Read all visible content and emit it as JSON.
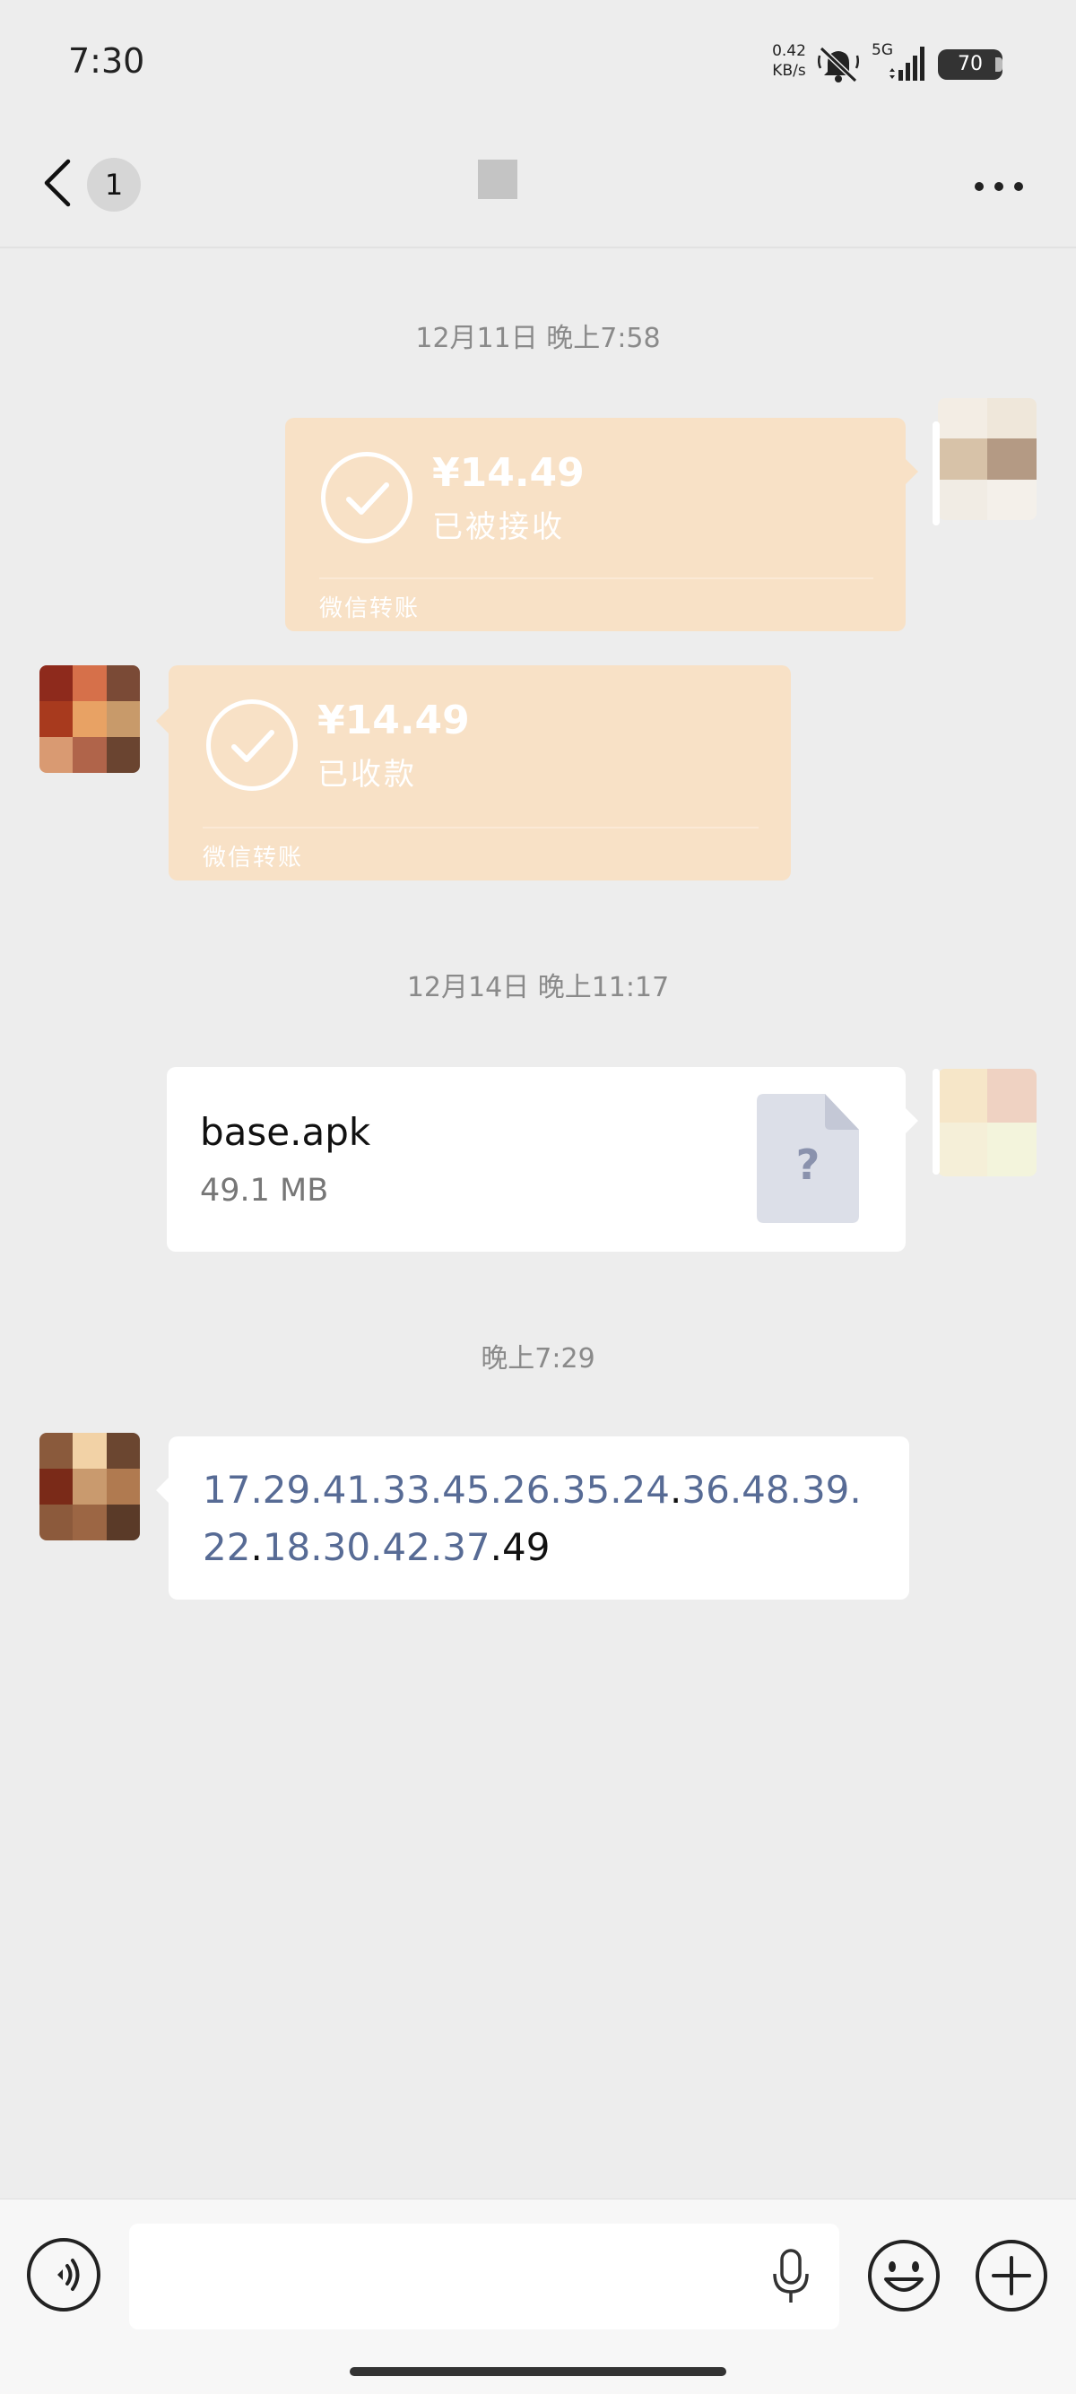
{
  "status_bar": {
    "time": "7:30",
    "net_speed_value": "0.42",
    "net_speed_unit": "KB/s",
    "network": "5G",
    "battery": "70"
  },
  "nav": {
    "back_icon": "chevron-left-icon",
    "unread_count": "1",
    "more_icon": "ellipsis-icon"
  },
  "messages": [
    {
      "type": "timestamp",
      "text": "12月11日 晚上7:58"
    },
    {
      "type": "transfer",
      "side": "right",
      "amount": "¥14.49",
      "status": "已被接收",
      "footer": "微信转账"
    },
    {
      "type": "transfer",
      "side": "left",
      "amount": "¥14.49",
      "status": "已收款",
      "footer": "微信转账"
    },
    {
      "type": "timestamp",
      "text": "12月14日 晚上11:17"
    },
    {
      "type": "file",
      "side": "right",
      "name": "base.apk",
      "size": "49.1 MB",
      "icon": "unknown-file-icon",
      "icon_glyph": "?"
    },
    {
      "type": "timestamp",
      "text": "晚上7:29"
    },
    {
      "type": "text",
      "side": "left",
      "segments": [
        "17.29.41.33.45.26.35.24",
        ".",
        "36.48.39.22",
        ".",
        "18.30.42.37",
        ".49"
      ]
    }
  ],
  "input_bar": {
    "voice_icon": "voice-mode-icon",
    "mic_icon": "microphone-icon",
    "emoji_icon": "emoji-icon",
    "plus_icon": "plus-icon"
  },
  "colors": {
    "background": "#ededed",
    "transfer_card": "#f8e1c6",
    "link_text": "#576b95",
    "timestamp_text": "#8a8a8a"
  }
}
